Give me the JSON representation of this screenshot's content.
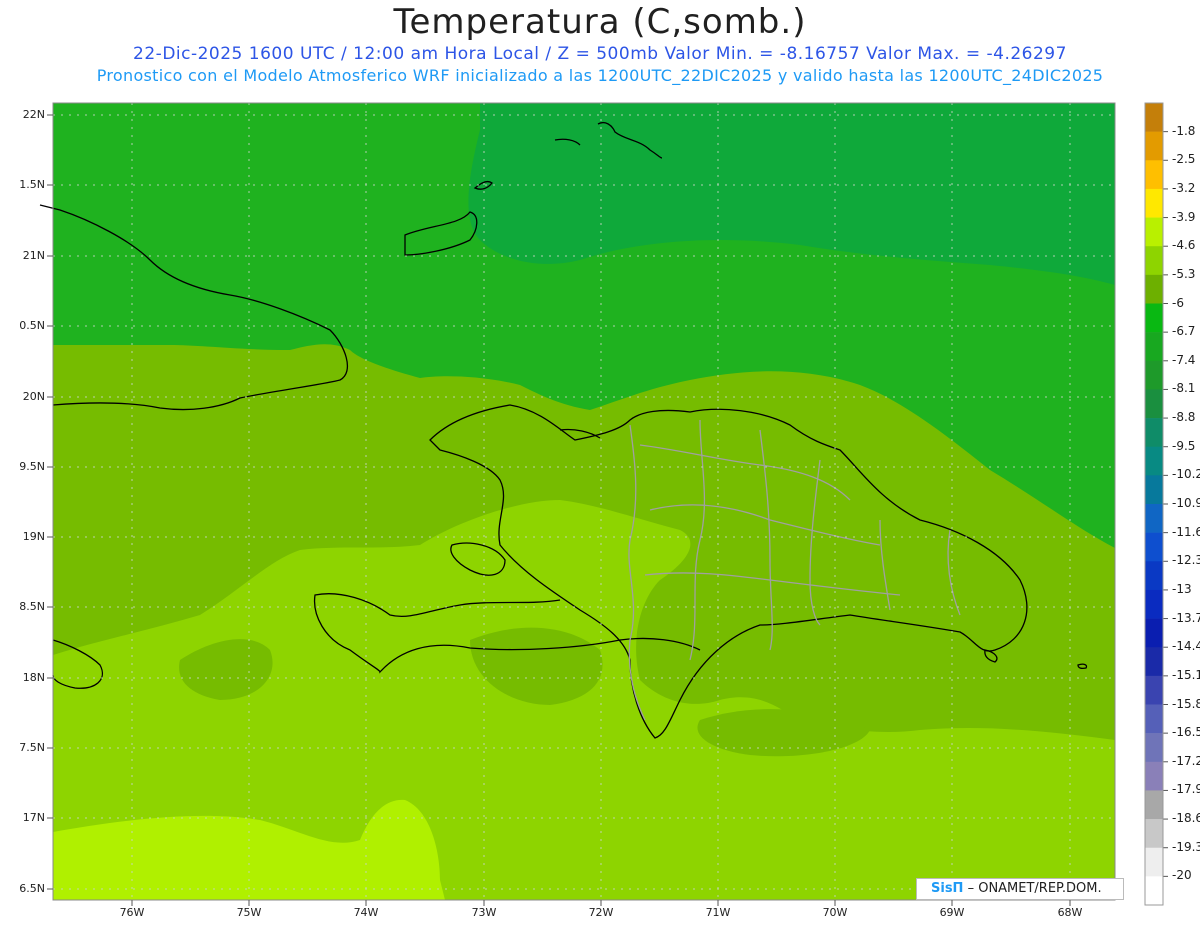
{
  "title": "Temperatura (C,somb.)",
  "subtitle1": "22-Dic-2025  1600 UTC / 12:00 am Hora Local / Z = 500mb  Valor Min. = -8.16757  Valor Max. = -4.26297",
  "subtitle2": "Pronostico con el Modelo Atmosferico WRF inicializado a las 1200UTC_22DIC2025 y valido hasta las  1200UTC_24DIC2025",
  "credit": {
    "logo": "SisΠ",
    "text": "– ONAMET/REP.DOM."
  },
  "lat_labels": [
    "22N",
    "1.5N",
    "21N",
    "0.5N",
    "20N",
    "9.5N",
    "19N",
    "8.5N",
    "18N",
    "7.5N",
    "17N",
    "6.5N"
  ],
  "lon_labels": [
    "76W",
    "75W",
    "74W",
    "73W",
    "72W",
    "71W",
    "70W",
    "69W",
    "68W"
  ],
  "legend": {
    "labels": [
      "-1.8",
      "-2.5",
      "-3.2",
      "-3.9",
      "-4.6",
      "-5.3",
      "-6",
      "-6.7",
      "-7.4",
      "-8.1",
      "-8.8",
      "-9.5",
      "-10.2",
      "-10.9",
      "-11.6",
      "-12.3",
      "-13",
      "-13.7",
      "-14.4",
      "-15.1",
      "-15.8",
      "-16.5",
      "-17.2",
      "-17.9",
      "-18.6",
      "-19.3",
      "-20"
    ],
    "colors": [
      "#c47f0a",
      "#e39b00",
      "#ffbf00",
      "#ffe800",
      "#b9f000",
      "#8ed400",
      "#6db000",
      "#09b812",
      "#18a820",
      "#1e9a2a",
      "#1a8f3f",
      "#0f8c68",
      "#088a83",
      "#07799c",
      "#1066c4",
      "#0e4fcf",
      "#0a39c4",
      "#0a2bc0",
      "#0a1eb0",
      "#1a2aa8",
      "#3a44b0",
      "#5560b8",
      "#6f74b8",
      "#8a80b8",
      "#a8a8a8",
      "#c8c8c8",
      "#eeeeee",
      "#ffffff"
    ]
  },
  "shade_colors": {
    "lightest": "#b0f000",
    "light": "#8ed400",
    "mid": "#76bc00",
    "dark": "#1fb21f",
    "darker": "#0fa93a",
    "border": "#000000",
    "provinces": "#a0a0a0"
  }
}
